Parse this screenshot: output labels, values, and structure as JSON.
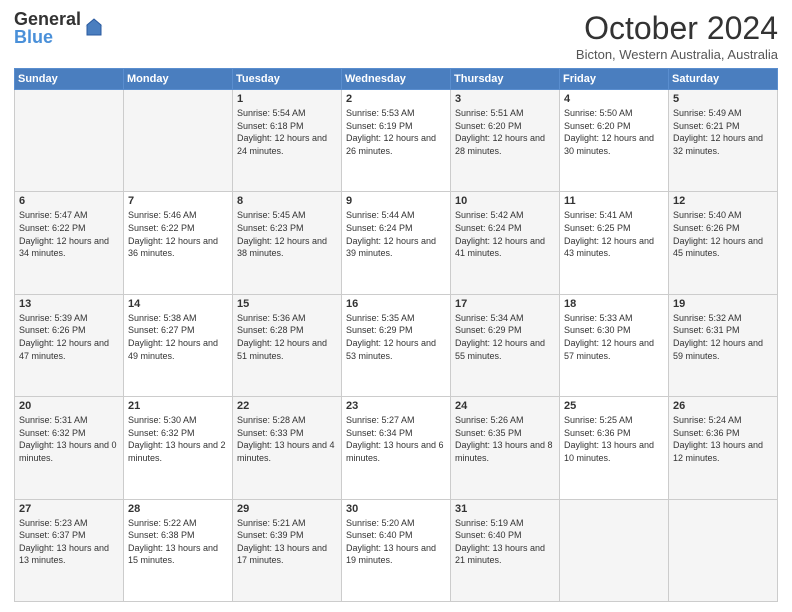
{
  "logo": {
    "general": "General",
    "blue": "Blue"
  },
  "title": "October 2024",
  "location": "Bicton, Western Australia, Australia",
  "days_of_week": [
    "Sunday",
    "Monday",
    "Tuesday",
    "Wednesday",
    "Thursday",
    "Friday",
    "Saturday"
  ],
  "weeks": [
    [
      {
        "day": "",
        "info": ""
      },
      {
        "day": "",
        "info": ""
      },
      {
        "day": "1",
        "info": "Sunrise: 5:54 AM\nSunset: 6:18 PM\nDaylight: 12 hours and 24 minutes."
      },
      {
        "day": "2",
        "info": "Sunrise: 5:53 AM\nSunset: 6:19 PM\nDaylight: 12 hours and 26 minutes."
      },
      {
        "day": "3",
        "info": "Sunrise: 5:51 AM\nSunset: 6:20 PM\nDaylight: 12 hours and 28 minutes."
      },
      {
        "day": "4",
        "info": "Sunrise: 5:50 AM\nSunset: 6:20 PM\nDaylight: 12 hours and 30 minutes."
      },
      {
        "day": "5",
        "info": "Sunrise: 5:49 AM\nSunset: 6:21 PM\nDaylight: 12 hours and 32 minutes."
      }
    ],
    [
      {
        "day": "6",
        "info": "Sunrise: 5:47 AM\nSunset: 6:22 PM\nDaylight: 12 hours and 34 minutes."
      },
      {
        "day": "7",
        "info": "Sunrise: 5:46 AM\nSunset: 6:22 PM\nDaylight: 12 hours and 36 minutes."
      },
      {
        "day": "8",
        "info": "Sunrise: 5:45 AM\nSunset: 6:23 PM\nDaylight: 12 hours and 38 minutes."
      },
      {
        "day": "9",
        "info": "Sunrise: 5:44 AM\nSunset: 6:24 PM\nDaylight: 12 hours and 39 minutes."
      },
      {
        "day": "10",
        "info": "Sunrise: 5:42 AM\nSunset: 6:24 PM\nDaylight: 12 hours and 41 minutes."
      },
      {
        "day": "11",
        "info": "Sunrise: 5:41 AM\nSunset: 6:25 PM\nDaylight: 12 hours and 43 minutes."
      },
      {
        "day": "12",
        "info": "Sunrise: 5:40 AM\nSunset: 6:26 PM\nDaylight: 12 hours and 45 minutes."
      }
    ],
    [
      {
        "day": "13",
        "info": "Sunrise: 5:39 AM\nSunset: 6:26 PM\nDaylight: 12 hours and 47 minutes."
      },
      {
        "day": "14",
        "info": "Sunrise: 5:38 AM\nSunset: 6:27 PM\nDaylight: 12 hours and 49 minutes."
      },
      {
        "day": "15",
        "info": "Sunrise: 5:36 AM\nSunset: 6:28 PM\nDaylight: 12 hours and 51 minutes."
      },
      {
        "day": "16",
        "info": "Sunrise: 5:35 AM\nSunset: 6:29 PM\nDaylight: 12 hours and 53 minutes."
      },
      {
        "day": "17",
        "info": "Sunrise: 5:34 AM\nSunset: 6:29 PM\nDaylight: 12 hours and 55 minutes."
      },
      {
        "day": "18",
        "info": "Sunrise: 5:33 AM\nSunset: 6:30 PM\nDaylight: 12 hours and 57 minutes."
      },
      {
        "day": "19",
        "info": "Sunrise: 5:32 AM\nSunset: 6:31 PM\nDaylight: 12 hours and 59 minutes."
      }
    ],
    [
      {
        "day": "20",
        "info": "Sunrise: 5:31 AM\nSunset: 6:32 PM\nDaylight: 13 hours and 0 minutes."
      },
      {
        "day": "21",
        "info": "Sunrise: 5:30 AM\nSunset: 6:32 PM\nDaylight: 13 hours and 2 minutes."
      },
      {
        "day": "22",
        "info": "Sunrise: 5:28 AM\nSunset: 6:33 PM\nDaylight: 13 hours and 4 minutes."
      },
      {
        "day": "23",
        "info": "Sunrise: 5:27 AM\nSunset: 6:34 PM\nDaylight: 13 hours and 6 minutes."
      },
      {
        "day": "24",
        "info": "Sunrise: 5:26 AM\nSunset: 6:35 PM\nDaylight: 13 hours and 8 minutes."
      },
      {
        "day": "25",
        "info": "Sunrise: 5:25 AM\nSunset: 6:36 PM\nDaylight: 13 hours and 10 minutes."
      },
      {
        "day": "26",
        "info": "Sunrise: 5:24 AM\nSunset: 6:36 PM\nDaylight: 13 hours and 12 minutes."
      }
    ],
    [
      {
        "day": "27",
        "info": "Sunrise: 5:23 AM\nSunset: 6:37 PM\nDaylight: 13 hours and 13 minutes."
      },
      {
        "day": "28",
        "info": "Sunrise: 5:22 AM\nSunset: 6:38 PM\nDaylight: 13 hours and 15 minutes."
      },
      {
        "day": "29",
        "info": "Sunrise: 5:21 AM\nSunset: 6:39 PM\nDaylight: 13 hours and 17 minutes."
      },
      {
        "day": "30",
        "info": "Sunrise: 5:20 AM\nSunset: 6:40 PM\nDaylight: 13 hours and 19 minutes."
      },
      {
        "day": "31",
        "info": "Sunrise: 5:19 AM\nSunset: 6:40 PM\nDaylight: 13 hours and 21 minutes."
      },
      {
        "day": "",
        "info": ""
      },
      {
        "day": "",
        "info": ""
      }
    ]
  ]
}
